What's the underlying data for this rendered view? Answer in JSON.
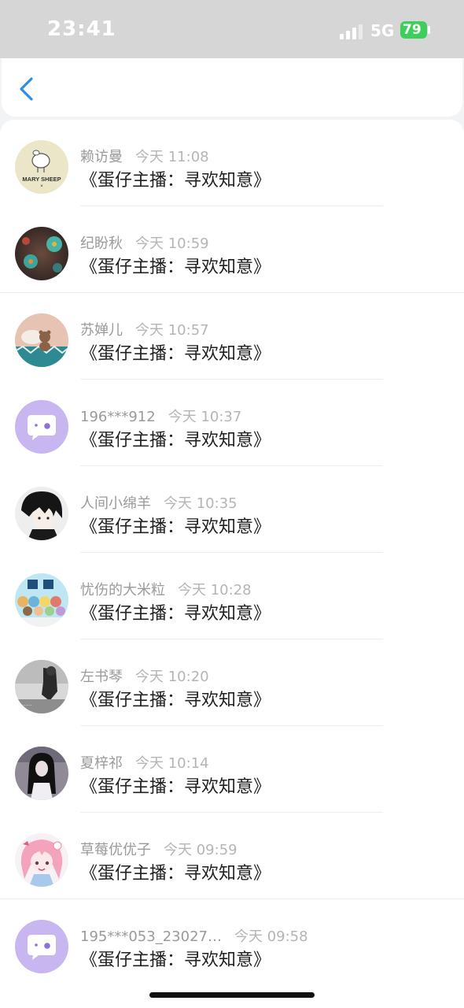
{
  "status_bar": {
    "time": "23:41",
    "network": "5G",
    "battery": "79"
  },
  "messages": [
    {
      "name": "赖访曼",
      "time": "今天 11:08",
      "text": "《蛋仔主播：寻欢知意》",
      "avatar": "mary-sheep-logo"
    },
    {
      "name": "纪盼秋",
      "time": "今天 10:59",
      "text": "《蛋仔主播：寻欢知意》",
      "avatar": "flower-photo"
    },
    {
      "name": "苏婵儿",
      "time": "今天 10:57",
      "text": "《蛋仔主播：寻欢知意》",
      "avatar": "teddy-bear-photo"
    },
    {
      "name": "196***912",
      "time": "今天 10:37",
      "text": "《蛋仔主播：寻欢知意》",
      "avatar": "default-chat-avatar"
    },
    {
      "name": "人间小绵羊",
      "time": "今天 10:35",
      "text": "《蛋仔主播：寻欢知意》",
      "avatar": "anime-boy"
    },
    {
      "name": "忧伤的大米粒",
      "time": "今天 10:28",
      "text": "《蛋仔主播：寻欢知意》",
      "avatar": "cartoon-group"
    },
    {
      "name": "左书琴",
      "time": "今天 10:20",
      "text": "《蛋仔主播：寻欢知意》",
      "avatar": "grayscale-photo"
    },
    {
      "name": "夏梓祁",
      "time": "今天 10:14",
      "text": "《蛋仔主播：寻欢知意》",
      "avatar": "girl-photo"
    },
    {
      "name": "草莓优优子",
      "time": "今天 09:59",
      "text": "《蛋仔主播：寻欢知意》",
      "avatar": "pink-anime-girl"
    },
    {
      "name": "195***053_23027…",
      "time": "今天 09:58",
      "text": "《蛋仔主播：寻欢知意》",
      "avatar": "default-chat-avatar"
    }
  ],
  "avatar_logo_text": "MARY SHEEP",
  "colors": {
    "accent": "#2f8ee8",
    "default_avatar": "#c7b6ef",
    "battery": "#3ecf5b"
  }
}
